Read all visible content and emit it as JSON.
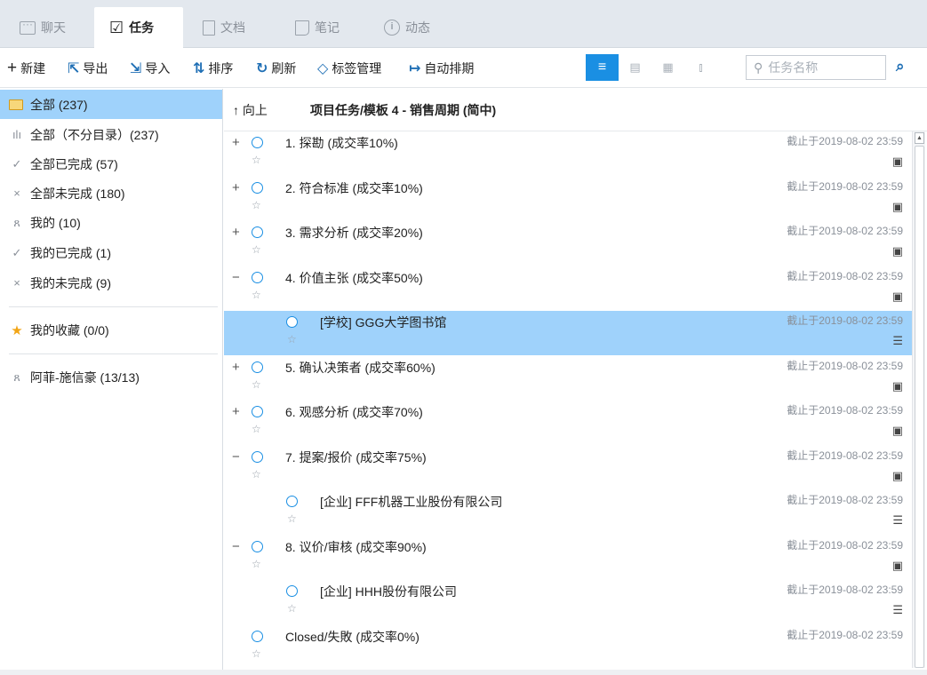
{
  "tabs": [
    {
      "label": "聊天",
      "icon": "chat-icon",
      "active": false
    },
    {
      "label": "任务",
      "icon": "task-icon",
      "active": true
    },
    {
      "label": "文档",
      "icon": "document-icon",
      "active": false
    },
    {
      "label": "笔记",
      "icon": "note-icon",
      "active": false
    },
    {
      "label": "动态",
      "icon": "info-icon",
      "active": false
    }
  ],
  "toolbar": {
    "new": "新建",
    "export": "导出",
    "import": "导入",
    "sort": "排序",
    "refresh": "刷新",
    "tags": "标签管理",
    "auto_schedule": "自动排期",
    "search_placeholder": "任务名称",
    "view_modes": [
      "list-view",
      "card-view",
      "calendar-view",
      "chart-view"
    ],
    "active_view": "list-view"
  },
  "sidebar": {
    "items": [
      {
        "label": "全部 (237)",
        "icon": "folder-icon"
      },
      {
        "label": "全部（不分目录）(237)",
        "icon": "bars-icon"
      },
      {
        "label": "全部已完成 (57)",
        "icon": "check-icon"
      },
      {
        "label": "全部未完成 (180)",
        "icon": "cross-icon"
      },
      {
        "label": "我的 (10)",
        "icon": "person-icon"
      },
      {
        "label": "我的已完成 (1)",
        "icon": "person-check-icon"
      },
      {
        "label": "我的未完成 (9)",
        "icon": "person-cross-icon"
      },
      {
        "label": "我的收藏 (0/0)",
        "icon": "star-icon"
      },
      {
        "label": "阿菲-施信豪 (13/13)",
        "icon": "person-icon"
      }
    ]
  },
  "main": {
    "up_label": "向上",
    "path": "项目任务/模板 4 - 销售周期 (简中)",
    "rows": [
      {
        "expander": "+",
        "title": "1. 探勘 (成交率10%)",
        "due": "截止于2019-08-02 23:59",
        "icon": "clipboard-icon",
        "level": 0
      },
      {
        "expander": "+",
        "title": "2. 符合标准 (成交率10%)",
        "due": "截止于2019-08-02 23:59",
        "icon": "clipboard-icon",
        "level": 0
      },
      {
        "expander": "+",
        "title": "3. 需求分析 (成交率20%)",
        "due": "截止于2019-08-02 23:59",
        "icon": "clipboard-icon",
        "level": 0
      },
      {
        "expander": "−",
        "title": "4. 价值主张 (成交率50%)",
        "due": "截止于2019-08-02 23:59",
        "icon": "clipboard-icon",
        "level": 0
      },
      {
        "expander": "",
        "title": "[学校] GGG大学图书馆",
        "due": "截止于2019-08-02 23:59",
        "icon": "checklist-icon",
        "level": 1,
        "selected": true
      },
      {
        "expander": "+",
        "title": "5. 确认决策者 (成交率60%)",
        "due": "截止于2019-08-02 23:59",
        "icon": "clipboard-icon",
        "level": 0
      },
      {
        "expander": "+",
        "title": "6. 观感分析 (成交率70%)",
        "due": "截止于2019-08-02 23:59",
        "icon": "clipboard-icon",
        "level": 0
      },
      {
        "expander": "−",
        "title": "7. 提案/报价 (成交率75%)",
        "due": "截止于2019-08-02 23:59",
        "icon": "clipboard-icon",
        "level": 0
      },
      {
        "expander": "",
        "title": "[企业] FFF机器工业股份有限公司",
        "due": "截止于2019-08-02 23:59",
        "icon": "checklist-icon",
        "level": 1
      },
      {
        "expander": "−",
        "title": "8. 议价/审核 (成交率90%)",
        "due": "截止于2019-08-02 23:59",
        "icon": "clipboard-icon",
        "level": 0
      },
      {
        "expander": "",
        "title": "[企业] HHH股份有限公司",
        "due": "截止于2019-08-02 23:59",
        "icon": "checklist-icon",
        "level": 1
      },
      {
        "expander": "",
        "title": "Closed/失敗 (成交率0%)",
        "due": "截止于2019-08-02 23:59",
        "icon": "",
        "level": 0
      }
    ]
  }
}
